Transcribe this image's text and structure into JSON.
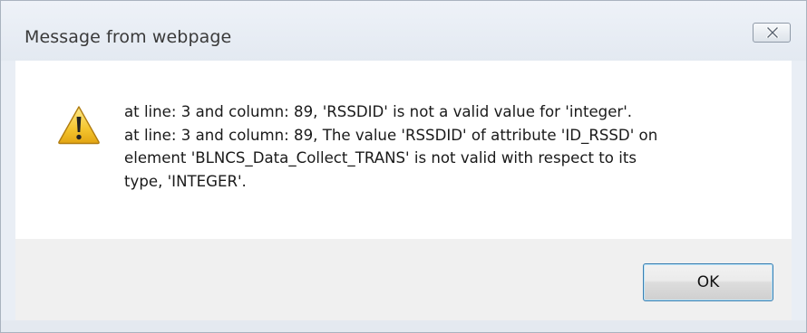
{
  "window": {
    "title": "Message from webpage",
    "close_icon": "close-icon"
  },
  "message": {
    "icon": "warning-icon",
    "lines": [
      "at line: 3 and column: 89, 'RSSDID' is not a valid value for 'integer'.",
      "at line: 3 and column: 89, The value 'RSSDID' of attribute 'ID_RSSD' on",
      "element 'BLNCS_Data_Collect_TRANS' is not valid with respect to its",
      "type, 'INTEGER'."
    ]
  },
  "buttons": {
    "ok_label": "OK"
  },
  "colors": {
    "warning_fill": "#f2c12e",
    "accent_border": "#3c7fb1"
  }
}
